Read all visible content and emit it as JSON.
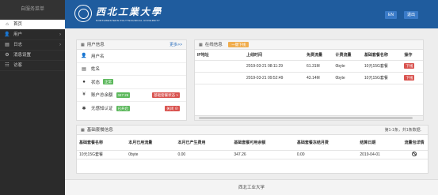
{
  "sidebar": {
    "title": "自服务菜单",
    "items": [
      {
        "label": "首页",
        "icon": "home-icon",
        "glyph": "⌂"
      },
      {
        "label": "用户",
        "icon": "user-icon",
        "glyph": "👤"
      },
      {
        "label": "日志",
        "icon": "doc-icon",
        "glyph": "▤"
      },
      {
        "label": "消息设置",
        "icon": "gear-icon",
        "glyph": "⚙"
      },
      {
        "label": "访客",
        "icon": "visitor-icon",
        "glyph": "☷"
      }
    ]
  },
  "header": {
    "logo_cn": "西北工業大學",
    "logo_en": "NORTHWESTERN POLYTECHNICAL UNIVERSITY",
    "lang_button": "EN",
    "logout_button": "退出",
    "bg_color": "#1f5c9e"
  },
  "user_panel": {
    "title": "用户信息",
    "more": "更多>>",
    "rows": {
      "username": "用户名",
      "name": "姓名",
      "status": "状态",
      "status_tag": "正常",
      "balance": "账户总余额",
      "balance_value": "347.26",
      "balance_tag": "基础套餐状态 >",
      "noauth": "无感知认证",
      "noauth_tag": "已开启",
      "noauth_close": "关闭 ⊘"
    }
  },
  "online_panel": {
    "title": "在线信息",
    "warn": "一键下线",
    "headers": [
      "IP地址",
      "上线时间",
      "免费流量",
      "计费流量",
      "基础套餐名称",
      "操作"
    ],
    "rows": [
      {
        "ip": "",
        "time": "2019-03-21 08:11:29",
        "free": "61.31M",
        "billed": "0byte",
        "pkg": "10元15G套餐",
        "op": "下线"
      },
      {
        "ip": "",
        "time": "2019-03-21 09:52:49",
        "free": "43.14M",
        "billed": "0byte",
        "pkg": "10元15G套餐",
        "op": "下线"
      }
    ]
  },
  "pkg_panel": {
    "title": "基础套餐信息",
    "pager": "第1-1条，共1条数据.",
    "headers": [
      "基础套餐名称",
      "本月已用流量",
      "本月已产生费用",
      "基础套餐可用余额",
      "基础套餐冻结月费",
      "结算日期",
      "流量包详情"
    ],
    "rows": [
      {
        "name": "10元15G套餐",
        "used": "0byte",
        "fee": "0.00",
        "avail": "347.26",
        "frozen": "0.00",
        "date": "2019-04-01"
      }
    ]
  },
  "footer": "西北工业大学"
}
